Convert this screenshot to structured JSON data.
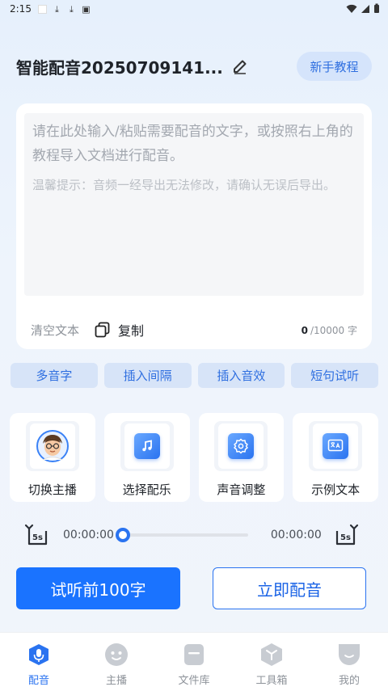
{
  "status_bar": {
    "time": "2:15"
  },
  "header": {
    "title": "智能配音20250709141...",
    "tutorial_label": "新手教程"
  },
  "editor": {
    "placeholder": "请在此处输入/粘贴需要配音的文字，或按照右上角的教程导入文档进行配音。",
    "tip": "温馨提示：音频一经导出无法修改，请确认无误后导出。",
    "clear_label": "清空文本",
    "copy_label": "复制",
    "count": "0",
    "limit": "/10000 字"
  },
  "tools": [
    {
      "label": "多音字"
    },
    {
      "label": "插入间隔"
    },
    {
      "label": "插入音效"
    },
    {
      "label": "短句试听"
    }
  ],
  "features": [
    {
      "label": "切换主播",
      "icon": "avatar-icon"
    },
    {
      "label": "选择配乐",
      "icon": "music-note-icon"
    },
    {
      "label": "声音调整",
      "icon": "gear-icon"
    },
    {
      "label": "示例文本",
      "icon": "translate-icon"
    }
  ],
  "player": {
    "current": "00:00:00",
    "total": "00:00:00",
    "rewind_label": "5s",
    "forward_label": "5s",
    "progress": 0
  },
  "actions": {
    "preview_label": "试听前100字",
    "dub_label": "立即配音"
  },
  "tabs": [
    {
      "label": "配音",
      "active": true
    },
    {
      "label": "主播"
    },
    {
      "label": "文件库"
    },
    {
      "label": "工具箱"
    },
    {
      "label": "我的"
    }
  ],
  "colors": {
    "accent": "#1a73ff",
    "tool_bg": "#d7e4f8",
    "inactive_icon": "#c8ccd2"
  }
}
